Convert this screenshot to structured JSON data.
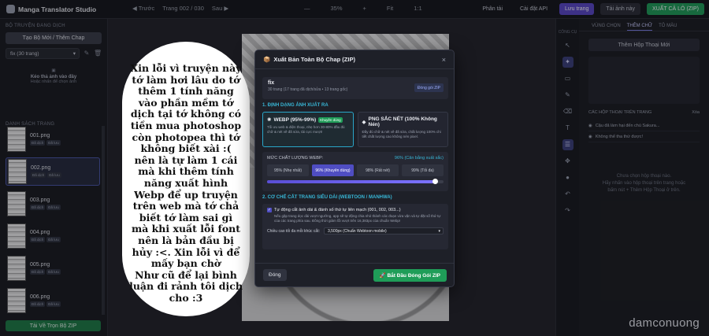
{
  "app": {
    "title": "Manga Translator Studio"
  },
  "topbar": {
    "prev": "◀ Trước",
    "page_info": "Trang 002 / 030",
    "next": "Sau ▶",
    "minus": "—",
    "zoom": "35%",
    "plus": "+",
    "fit": "Fit",
    "actual": "1:1",
    "analyze": "Phân tải",
    "api_settings": "Cài đặt API",
    "save_page": "Lưu trang",
    "download_page": "Tải ảnh này",
    "download_all": "XUẤT CẢ LÔ (ZIP)"
  },
  "left": {
    "section_batch": "BỘ TRUYỆN ĐANG DỊCH",
    "new_chap_button": "Tạo Bộ Mới / Thêm Chap",
    "chap_select": "fix (30 trang)",
    "empty_title": "Kéo thả ảnh vào đây",
    "empty_sub": "Hoặc nhấn để chọn ảnh",
    "section_pages": "DANH SÁCH TRANG",
    "pages": [
      {
        "name": "001.png",
        "tag1": "Đã dịch",
        "tag2": "Đã lưu"
      },
      {
        "name": "002.png",
        "tag1": "Đã dịch",
        "tag2": "Đã lưu"
      },
      {
        "name": "003.png",
        "tag1": "Đã dịch",
        "tag2": "Đã lưu"
      },
      {
        "name": "004.png",
        "tag1": "Đã dịch",
        "tag2": "Đã lưu"
      },
      {
        "name": "005.png",
        "tag1": "Đã dịch",
        "tag2": "Đã lưu"
      },
      {
        "name": "006.png",
        "tag1": "Đã dịch",
        "tag2": "Đã lưu"
      }
    ],
    "download_button": "Tải Về Trọn Bộ ZIP"
  },
  "bubble": {
    "text": "Xin lỗi vì truyện này\ntớ làm hơi lâu do tớ\nthêm 1 tính năng\nvào phần mềm tớ\ndịch tại tớ không có\ntiền mua photoshop\ncòn photopea thì tớ\nkhông biết xài :(\nnên là tự làm 1 cái\nmà khi thêm tính\nnăng xuất hình\nWebp để up truyện\ntrên web mà tớ chả\nbiết tớ làm sai gì\nmà khi xuất lỗi font\nnên là bản đầu bị\nhủy :<. Xin lỗi vì để\nmấy bạn chờ\nNhư cũ để lại bình\nluận đi rảnh tôi dịch\ncho :3"
  },
  "tools": {
    "label": "CÔNG CỤ"
  },
  "right": {
    "tab1": "VÙNG CHỌN",
    "tab2": "THÊM CHỮ",
    "tab3": "TÔ MÀU",
    "add_bubble": "Thêm Hộp Thoại Mới",
    "list_header": "CÁC HỘP THOẠI TRÊN TRANG",
    "clear": "Xóa",
    "items": [
      "Cậu đã làm hại đến chú Sakura...",
      "Không thể tha thứ được!"
    ],
    "empty": "Chưa chọn hộp thoại nào.\nHãy nhấn vào hộp thoại trên trang hoặc\nbấm nút + Thêm Hộp Thoại ở trên."
  },
  "modal": {
    "title": "Xuất Bản Toàn Bộ Chap (ZIP)",
    "close": "×",
    "info_title": "fix",
    "info_sub": "30 trang (17 trang đã dịch/sửa • 13 trang gốc)",
    "info_badge": "Đóng gói ZIP",
    "sec1": "1. ĐỊNH DẠNG ẢNH XUẤT RA",
    "webp_title": "WEBP (95%-99%)",
    "webp_badge": "Khuyên dùng",
    "webp_desc": "Tối ưu web & điện thoại, nhẹ hơn 30-80% đầu đủ chữ & nét vẽ đã sửa, tải cực mượt!",
    "png_title": "PNG SẮC NÉT (100% Không Nén)",
    "png_desc": "Đầy đủ chữ & nét vẽ đã sửa, chất lượng 100% chi tiết chất lượng cao không nén pixel.",
    "quality_label": "MỨC CHẤT LƯỢNG WEBP:",
    "quality_value": "96% (Cân bằng xuất sắc)",
    "q_options": [
      "95% (Nhẹ nhất)",
      "96% (Khuyên dùng)",
      "98% (Rất nét)",
      "99% (Tối đa)"
    ],
    "quality_level": 0.95,
    "sec2": "2. CƠ CHẾ CẮT TRANG SIÊU DÀI (WEBTOON / MANHWA)",
    "cut_label": "Tự động cắt ảnh dài & đánh số thứ tự liên mạch (001, 002, 003...)",
    "cut_desc": "Nếu gặp trang dọc dài vượt ngưỡng, app sẽ tự động chia nhỏ thành các đoạn vừa vặn và tự đặt số thứ tự của các trang phía sau. Đồng thời giảm lỗi vượt trên 16,383px của chuẩn Webp!",
    "max_label": "Chiều cao tối đa mỗi khúc cắt:",
    "max_value": "3,500px (Chuẩn Webtoon mobile)",
    "close_button": "Đóng",
    "start_button": "Bắt Đầu Đóng Gói ZIP"
  },
  "watermark": "damconuong"
}
